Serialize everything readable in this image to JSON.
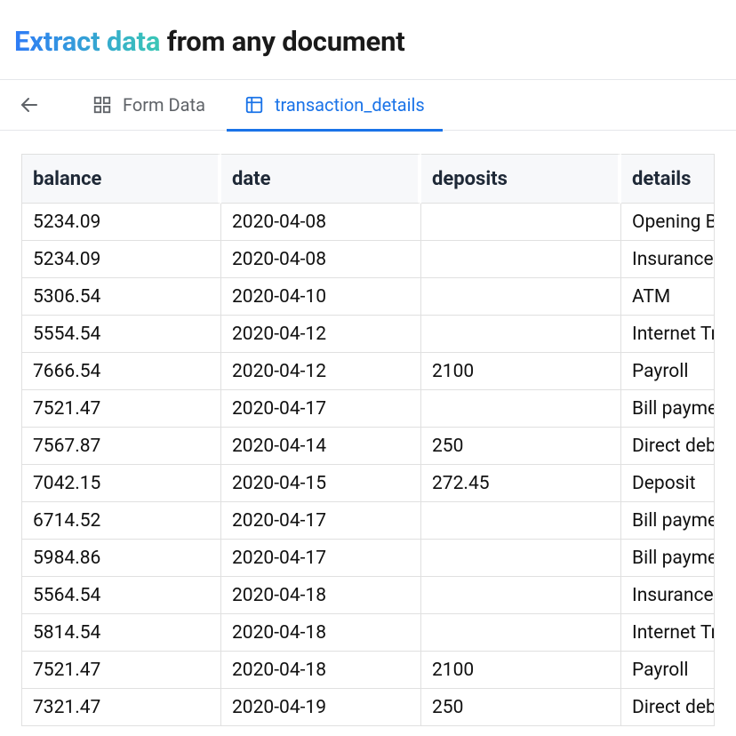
{
  "header": {
    "accent_text": "Extract data",
    "rest_text": " from any document"
  },
  "tabs": [
    {
      "label": "Form Data"
    },
    {
      "label": "transaction_details"
    }
  ],
  "table": {
    "columns": [
      "balance",
      "date",
      "deposits",
      "details"
    ],
    "rows": [
      {
        "balance": "5234.09",
        "date": "2020-04-08",
        "deposits": "",
        "details": "Opening Ba"
      },
      {
        "balance": "5234.09",
        "date": "2020-04-08",
        "deposits": "",
        "details": "Insurance"
      },
      {
        "balance": "5306.54",
        "date": "2020-04-10",
        "deposits": "",
        "details": "ATM"
      },
      {
        "balance": "5554.54",
        "date": "2020-04-12",
        "deposits": "",
        "details": "Internet Tra"
      },
      {
        "balance": "7666.54",
        "date": "2020-04-12",
        "deposits": "2100",
        "details": "Payroll"
      },
      {
        "balance": "7521.47",
        "date": "2020-04-17",
        "deposits": "",
        "details": "Bill paymen"
      },
      {
        "balance": "7567.87",
        "date": "2020-04-14",
        "deposits": "250",
        "details": "Direct debi"
      },
      {
        "balance": "7042.15",
        "date": "2020-04-15",
        "deposits": "272.45",
        "details": "Deposit"
      },
      {
        "balance": "6714.52",
        "date": "2020-04-17",
        "deposits": "",
        "details": "Bill paymen"
      },
      {
        "balance": "5984.86",
        "date": "2020-04-17",
        "deposits": "",
        "details": "Bill paymen"
      },
      {
        "balance": "5564.54",
        "date": "2020-04-18",
        "deposits": "",
        "details": "Insurance"
      },
      {
        "balance": "5814.54",
        "date": "2020-04-18",
        "deposits": "",
        "details": "Internet Tra"
      },
      {
        "balance": "7521.47",
        "date": "2020-04-18",
        "deposits": "2100",
        "details": "Payroll"
      },
      {
        "balance": "7321.47",
        "date": "2020-04-19",
        "deposits": "250",
        "details": "Direct debi"
      }
    ]
  }
}
